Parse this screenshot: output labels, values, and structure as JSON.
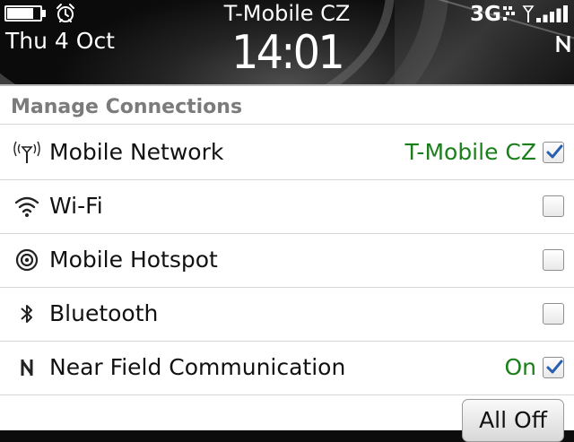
{
  "status_bar": {
    "date": "Thu 4 Oct",
    "carrier": "T-Mobile CZ",
    "time": "14:01",
    "network_type": "3G",
    "battery_level": 0.8,
    "signal_bars": 5
  },
  "panel": {
    "title": "Manage Connections",
    "rows": [
      {
        "label": "Mobile Network",
        "status": "T-Mobile CZ",
        "checked": true,
        "icon": "antenna-icon"
      },
      {
        "label": "Wi-Fi",
        "status": "",
        "checked": false,
        "icon": "wifi-icon"
      },
      {
        "label": "Mobile Hotspot",
        "status": "",
        "checked": false,
        "icon": "hotspot-icon"
      },
      {
        "label": "Bluetooth",
        "status": "",
        "checked": false,
        "icon": "bluetooth-icon"
      },
      {
        "label": "Near Field Communication",
        "status": "On",
        "checked": true,
        "icon": "nfc-icon"
      }
    ],
    "all_off_label": "All Off"
  },
  "colors": {
    "status_green": "#1a7f1a",
    "check_blue": "#2a5fb0",
    "title_gray": "#7b7b7b"
  }
}
